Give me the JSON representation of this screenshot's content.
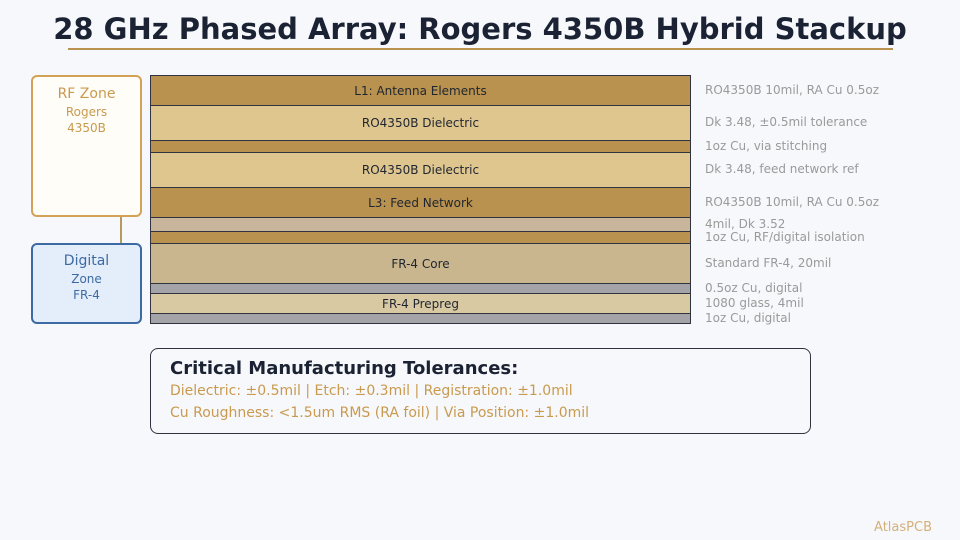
{
  "title": "28 GHz Phased Array: Rogers 4350B Hybrid Stackup",
  "zones": {
    "rf": {
      "title": "RF Zone",
      "line1": "Rogers",
      "line2": "4350B",
      "border_color": "#d4a257"
    },
    "digital": {
      "title": "Digital",
      "line1": "Zone",
      "line2": "FR-4",
      "border_color": "#3d6aa3"
    }
  },
  "layers": [
    {
      "label": "L1: Antenna Elements",
      "note": "RO4350B 10mil, RA Cu 0.5oz",
      "color": "#b8924e"
    },
    {
      "label": "RO4350B Dielectric",
      "note": "Dk 3.48, ±0.5mil tolerance",
      "color": "#dec68e"
    },
    {
      "label": "",
      "note": "1oz Cu, via stitching",
      "color": "#b8924e"
    },
    {
      "label": "RO4350B Dielectric",
      "note": "Dk 3.48, feed network ref",
      "color": "#dec68e"
    },
    {
      "label": "L3: Feed Network",
      "note": "RO4350B 10mil, RA Cu 0.5oz",
      "color": "#b8924e"
    },
    {
      "label": "",
      "note": "4mil, Dk 3.52",
      "color": "#c9b49c"
    },
    {
      "label": "",
      "note": "1oz Cu, RF/digital isolation",
      "color": "#b8924e"
    },
    {
      "label": "FR-4 Core",
      "note": "Standard FR-4, 20mil",
      "color": "#c9b68e"
    },
    {
      "label": "",
      "note": "0.5oz Cu, digital",
      "color": "#a4a4a8"
    },
    {
      "label": "FR-4 Prepreg",
      "note": "1080 glass, 4mil",
      "color": "#d8c9a3"
    },
    {
      "label": "",
      "note": "1oz Cu, digital",
      "color": "#a4a4a8"
    }
  ],
  "tolerances": {
    "title": "Critical Manufacturing Tolerances:",
    "line1": "Dielectric: ±0.5mil  |  Etch: ±0.3mil  |  Registration: ±1.0mil",
    "line2": "Cu Roughness: <1.5um RMS (RA foil)  |  Via Position: ±1.0mil"
  },
  "brand": "AtlasPCB"
}
